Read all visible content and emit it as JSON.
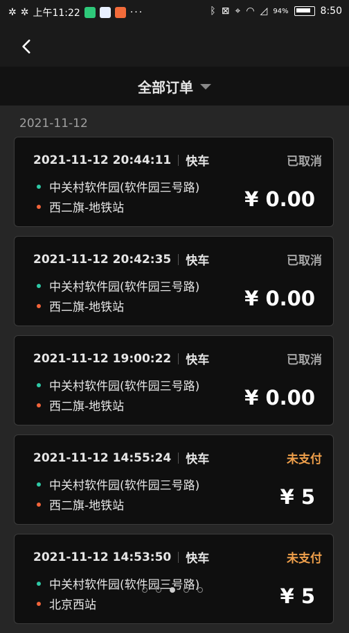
{
  "status_bar": {
    "time": "上午11:22",
    "clock": "8:50",
    "battery_text": "94%",
    "icons": [
      "sync-icon",
      "sync-icon",
      "wechat-app-icon",
      "chat-app-icon",
      "shop-app-icon",
      "bluetooth-icon",
      "no-sim-icon",
      "location-icon",
      "wifi-icon",
      "no-signal-icon",
      "battery-icon"
    ],
    "more": "···"
  },
  "nav": {
    "back_icon": "chevron-left-icon"
  },
  "filter": {
    "title": "全部订单",
    "caret_icon": "caret-down-icon"
  },
  "date_group": "2021-11-12",
  "colors": {
    "origin_dot": "#2ec9a7",
    "dest_dot": "#f2643a",
    "cancelled": "#a6a6a6",
    "unpaid": "#f0a04b"
  },
  "orders": [
    {
      "datetime": "2021-11-12 20:44:11",
      "type": "快车",
      "status": "已取消",
      "status_kind": "cancelled",
      "origin": "中关村软件园(软件园三号路)",
      "destination": "西二旗-地铁站",
      "price": "¥ 0.00"
    },
    {
      "datetime": "2021-11-12 20:42:35",
      "type": "快车",
      "status": "已取消",
      "status_kind": "cancelled",
      "origin": "中关村软件园(软件园三号路)",
      "destination": "西二旗-地铁站",
      "price": "¥ 0.00"
    },
    {
      "datetime": "2021-11-12 19:00:22",
      "type": "快车",
      "status": "已取消",
      "status_kind": "cancelled",
      "origin": "中关村软件园(软件园三号路)",
      "destination": "西二旗-地铁站",
      "price": "¥ 0.00"
    },
    {
      "datetime": "2021-11-12 14:55:24",
      "type": "快车",
      "status": "未支付",
      "status_kind": "unpaid",
      "origin": "中关村软件园(软件园三号路)",
      "destination": "西二旗-地铁站",
      "price": "¥ 5"
    },
    {
      "datetime": "2021-11-12 14:53:50",
      "type": "快车",
      "status": "未支付",
      "status_kind": "unpaid",
      "origin": "中关村软件园(软件园三号路)",
      "destination": "北京西站",
      "price": "¥ 5"
    }
  ],
  "pager": {
    "count": 5,
    "active_index": 2
  }
}
